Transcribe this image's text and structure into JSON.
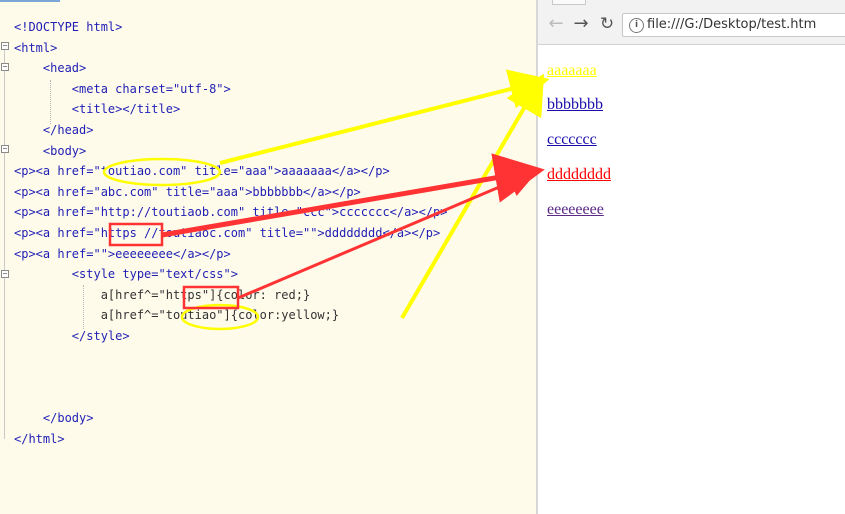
{
  "editor": {
    "lines": [
      "<!DOCTYPE html>",
      "<html>",
      "    <head>",
      "        <meta charset=\"utf-8\">",
      "        <title></title>",
      "    </head>",
      "    <body>",
      "<p><a href=\"toutiao.com\" title=\"aaa\">aaaaaaa</a></p>",
      "<p><a href=\"abc.com\" title=\"aaa\">bbbbbbb</a></p>",
      "<p><a href=\"http://toutiaob.com\" title=\"ccc\">ccccccc</a></p>",
      "<p><a href=\"https //toutiaoc.com\" title=\"\">dddddddd</a></p>",
      "<p><a href=\"\">eeeeeeee</a></p>",
      "        <style type=\"text/css\">",
      "            a[href^=\"https\"]{color: red;}",
      "            a[href^=\"toutiao\"]{color:yellow;}",
      "        </style>",
      "",
      "",
      "",
      "    </body>",
      "</html>"
    ]
  },
  "browser": {
    "url": "file:///G:/Desktop/test.htm",
    "links": [
      "aaaaaaa",
      "bbbbbbb",
      "ccccccc",
      "dddddddd",
      "eeeeeeee"
    ],
    "link_colors": {
      "yellow": "#ffff00",
      "default": "#1a0dab",
      "red": "#ff0000",
      "visited": "#5b2a86"
    }
  },
  "icons": {
    "back": "arrow-left-icon",
    "forward": "arrow-right-icon",
    "reload": "reload-icon",
    "info": "info-icon"
  },
  "annotation_colors": {
    "yellow": "#ffff00",
    "red": "#ff3333"
  }
}
